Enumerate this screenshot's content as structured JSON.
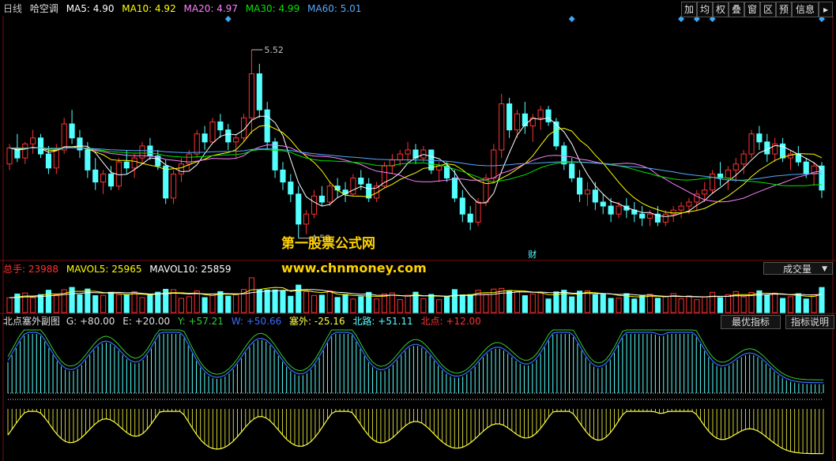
{
  "toolbar": {
    "buttons": [
      "加",
      "均",
      "权",
      "叠",
      "窗",
      "区",
      "预",
      "信息"
    ]
  },
  "main_header": {
    "period": "日线",
    "stock": "哈空调",
    "ma5": "MA5: 4.90",
    "ma10": "MA10: 4.92",
    "ma20": "MA20: 4.97",
    "ma30": "MA30: 4.99",
    "ma60": "MA60: 5.01"
  },
  "annotations": {
    "high": "5.52",
    "low": "4.58",
    "event": "财"
  },
  "watermark": {
    "line1": "第一股票公式网",
    "line2": "www.chnmoney.com"
  },
  "volume_header": {
    "total": "总手: 23988",
    "mavol5": "MAVOL5: 25965",
    "mavol10": "MAVOL10: 25859",
    "selector": "成交量",
    "selector_arrow": "▼"
  },
  "indicator_header": {
    "name": "北点塞外副图",
    "g": "G: +80.00",
    "e": "E: +20.00",
    "y": "Y: +57.21",
    "w": "W: +50.66",
    "saiwai": "塞外: -25.16",
    "beilu": "北路: +51.11",
    "beidian": "北点: +12.00",
    "btn_best": "最优指标",
    "btn_help": "指标说明"
  },
  "colors": {
    "up": "#ff3232",
    "down": "#54ffff",
    "ma5": "#ffffff",
    "ma10": "#ffff00",
    "ma20": "#ff80ff",
    "ma30": "#00e600",
    "ma60": "#55aaff",
    "marker": "#3fa9f5",
    "yline": "#ffff40",
    "wline": "#3c6cff",
    "gline": "#30d030",
    "bars": "#54ffff"
  },
  "chart_data": [
    {
      "type": "candlestick",
      "title": "哈空调",
      "period": "日线",
      "y_range": [
        4.5,
        5.65
      ],
      "annotated_high": 5.52,
      "annotated_low": 4.58,
      "ohlc": [
        [
          4.95,
          5.05,
          4.92,
          5.03
        ],
        [
          5.03,
          5.1,
          4.96,
          4.98
        ],
        [
          4.98,
          5.06,
          4.95,
          5.05
        ],
        [
          5.05,
          5.12,
          5.0,
          5.08
        ],
        [
          5.08,
          5.1,
          4.98,
          5.0
        ],
        [
          5.0,
          5.04,
          4.9,
          4.93
        ],
        [
          4.93,
          5.05,
          4.9,
          5.02
        ],
        [
          5.02,
          5.18,
          5.0,
          5.15
        ],
        [
          5.15,
          5.22,
          5.05,
          5.08
        ],
        [
          5.08,
          5.12,
          4.98,
          5.02
        ],
        [
          5.02,
          5.06,
          4.88,
          4.92
        ],
        [
          4.92,
          4.98,
          4.82,
          4.86
        ],
        [
          4.86,
          4.92,
          4.8,
          4.9
        ],
        [
          4.9,
          4.94,
          4.82,
          4.84
        ],
        [
          4.84,
          4.98,
          4.82,
          4.96
        ],
        [
          4.96,
          5.02,
          4.9,
          4.93
        ],
        [
          4.93,
          5.0,
          4.88,
          4.98
        ],
        [
          4.98,
          5.06,
          4.95,
          5.04
        ],
        [
          5.04,
          5.08,
          4.97,
          4.99
        ],
        [
          4.99,
          5.02,
          4.92,
          4.94
        ],
        [
          4.94,
          4.97,
          4.75,
          4.78
        ],
        [
          4.78,
          4.92,
          4.75,
          4.9
        ],
        [
          4.9,
          4.98,
          4.86,
          4.95
        ],
        [
          4.95,
          5.02,
          4.92,
          5.0
        ],
        [
          5.0,
          5.12,
          4.98,
          5.1
        ],
        [
          5.1,
          5.14,
          5.02,
          5.06
        ],
        [
          5.06,
          5.18,
          5.05,
          5.16
        ],
        [
          5.16,
          5.2,
          5.08,
          5.12
        ],
        [
          5.12,
          5.15,
          5.02,
          5.06
        ],
        [
          5.06,
          5.1,
          4.98,
          5.08
        ],
        [
          5.08,
          5.2,
          5.06,
          5.18
        ],
        [
          5.18,
          5.52,
          5.1,
          5.4
        ],
        [
          5.4,
          5.45,
          5.18,
          5.22
        ],
        [
          5.22,
          5.26,
          5.02,
          5.06
        ],
        [
          5.06,
          5.08,
          4.88,
          4.92
        ],
        [
          4.92,
          4.96,
          4.82,
          4.86
        ],
        [
          4.86,
          4.9,
          4.76,
          4.8
        ],
        [
          4.8,
          4.84,
          4.58,
          4.65
        ],
        [
          4.65,
          4.72,
          4.6,
          4.7
        ],
        [
          4.7,
          4.82,
          4.68,
          4.79
        ],
        [
          4.79,
          4.84,
          4.74,
          4.76
        ],
        [
          4.76,
          4.86,
          4.74,
          4.84
        ],
        [
          4.84,
          4.88,
          4.78,
          4.82
        ],
        [
          4.82,
          4.86,
          4.76,
          4.8
        ],
        [
          4.8,
          4.9,
          4.79,
          4.88
        ],
        [
          4.88,
          4.92,
          4.82,
          4.85
        ],
        [
          4.85,
          4.88,
          4.76,
          4.78
        ],
        [
          4.78,
          4.86,
          4.76,
          4.84
        ],
        [
          4.84,
          4.96,
          4.83,
          4.94
        ],
        [
          4.94,
          5.0,
          4.9,
          4.97
        ],
        [
          4.97,
          5.02,
          4.94,
          5.0
        ],
        [
          5.0,
          5.06,
          4.96,
          5.02
        ],
        [
          5.02,
          5.05,
          4.95,
          4.98
        ],
        [
          4.98,
          5.04,
          4.96,
          5.02
        ],
        [
          5.02,
          5.0,
          4.9,
          4.92
        ],
        [
          4.92,
          4.96,
          4.86,
          4.94
        ],
        [
          4.94,
          4.96,
          4.86,
          4.88
        ],
        [
          4.88,
          4.92,
          4.76,
          4.78
        ],
        [
          4.78,
          4.82,
          4.66,
          4.7
        ],
        [
          4.7,
          4.74,
          4.62,
          4.66
        ],
        [
          4.66,
          4.78,
          4.64,
          4.76
        ],
        [
          4.76,
          4.9,
          4.74,
          4.88
        ],
        [
          4.88,
          5.05,
          4.86,
          5.02
        ],
        [
          5.02,
          5.3,
          4.98,
          5.25
        ],
        [
          5.25,
          5.28,
          5.08,
          5.12
        ],
        [
          5.12,
          5.22,
          5.08,
          5.2
        ],
        [
          5.2,
          5.26,
          5.1,
          5.14
        ],
        [
          5.14,
          5.2,
          5.06,
          5.18
        ],
        [
          5.18,
          5.24,
          5.12,
          5.22
        ],
        [
          5.22,
          5.24,
          5.14,
          5.16
        ],
        [
          5.16,
          5.18,
          5.02,
          5.04
        ],
        [
          5.04,
          5.06,
          4.92,
          4.95
        ],
        [
          4.95,
          4.98,
          4.86,
          4.88
        ],
        [
          4.88,
          4.92,
          4.76,
          4.8
        ],
        [
          4.8,
          4.86,
          4.74,
          4.82
        ],
        [
          4.82,
          4.86,
          4.72,
          4.76
        ],
        [
          4.76,
          4.8,
          4.7,
          4.74
        ],
        [
          4.74,
          4.78,
          4.66,
          4.7
        ],
        [
          4.7,
          4.76,
          4.68,
          4.74
        ],
        [
          4.74,
          4.78,
          4.68,
          4.72
        ],
        [
          4.72,
          4.76,
          4.66,
          4.7
        ],
        [
          4.7,
          4.74,
          4.64,
          4.68
        ],
        [
          4.68,
          4.72,
          4.64,
          4.7
        ],
        [
          4.7,
          4.74,
          4.64,
          4.66
        ],
        [
          4.66,
          4.72,
          4.64,
          4.7
        ],
        [
          4.7,
          4.74,
          4.66,
          4.72
        ],
        [
          4.72,
          4.76,
          4.68,
          4.74
        ],
        [
          4.74,
          4.78,
          4.7,
          4.76
        ],
        [
          4.76,
          4.82,
          4.72,
          4.8
        ],
        [
          4.8,
          4.86,
          4.76,
          4.82
        ],
        [
          4.82,
          4.92,
          4.8,
          4.9
        ],
        [
          4.9,
          4.96,
          4.84,
          4.88
        ],
        [
          4.88,
          4.94,
          4.82,
          4.92
        ],
        [
          4.92,
          4.98,
          4.86,
          4.95
        ],
        [
          4.95,
          5.02,
          4.9,
          5.0
        ],
        [
          5.0,
          5.12,
          4.98,
          5.1
        ],
        [
          5.1,
          5.14,
          5.02,
          5.06
        ],
        [
          5.06,
          5.1,
          4.96,
          5.0
        ],
        [
          5.0,
          5.08,
          4.96,
          5.05
        ],
        [
          5.05,
          5.08,
          4.96,
          4.98
        ],
        [
          4.98,
          5.02,
          4.92,
          5.0
        ],
        [
          5.0,
          5.04,
          4.94,
          4.96
        ],
        [
          4.96,
          4.98,
          4.88,
          4.9
        ],
        [
          4.9,
          4.96,
          4.84,
          4.94
        ],
        [
          4.94,
          4.96,
          4.78,
          4.82
        ]
      ],
      "ma_labels": [
        "MA5",
        "MA10",
        "MA20",
        "MA30",
        "MA60"
      ],
      "ma_last": [
        4.9,
        4.92,
        4.97,
        4.99,
        5.01
      ]
    },
    {
      "type": "bar",
      "title": "成交量",
      "series_labels": [
        "总手",
        "MAVOL5",
        "MAVOL10"
      ],
      "last_values": [
        23988,
        25965,
        25859
      ]
    },
    {
      "type": "line",
      "title": "北点塞外副图",
      "series_labels": [
        "G",
        "E",
        "Y",
        "W",
        "塞外",
        "北路",
        "北点"
      ],
      "last_values": [
        80.0,
        20.0,
        57.21,
        50.66,
        -25.16,
        51.11,
        12.0
      ]
    }
  ]
}
